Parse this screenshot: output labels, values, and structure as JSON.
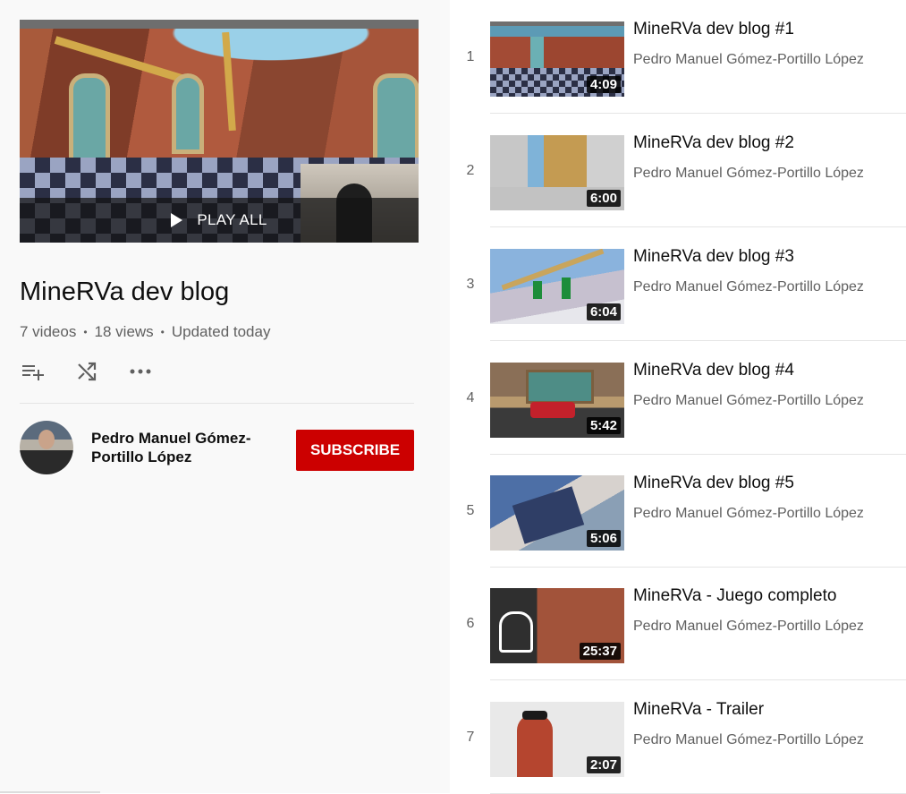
{
  "playlist": {
    "play_all_label": "PLAY ALL",
    "title": "MineRVa dev blog",
    "video_count": "7 videos",
    "views": "18 views",
    "updated": "Updated today",
    "stats_separator": "•"
  },
  "owner": {
    "name": "Pedro Manuel Gómez-Portillo López",
    "subscribe_label": "SUBSCRIBE"
  },
  "colors": {
    "subscribe": "#cc0000",
    "sidebar_bg": "#f9f9f9"
  },
  "icons": {
    "add_to_queue": "playlist-add-icon",
    "shuffle": "shuffle-icon",
    "more": "more-horiz-icon",
    "play": "play-icon"
  },
  "videos": [
    {
      "index": "1",
      "title": "MineRVa dev blog #1",
      "channel": "Pedro Manuel Gómez-Portillo López",
      "duration": "4:09"
    },
    {
      "index": "2",
      "title": "MineRVa dev blog #2",
      "channel": "Pedro Manuel Gómez-Portillo López",
      "duration": "6:00"
    },
    {
      "index": "3",
      "title": "MineRVa dev blog #3",
      "channel": "Pedro Manuel Gómez-Portillo López",
      "duration": "6:04"
    },
    {
      "index": "4",
      "title": "MineRVa dev blog #4",
      "channel": "Pedro Manuel Gómez-Portillo López",
      "duration": "5:42"
    },
    {
      "index": "5",
      "title": "MineRVa dev blog #5",
      "channel": "Pedro Manuel Gómez-Portillo López",
      "duration": "5:06"
    },
    {
      "index": "6",
      "title": "MineRVa - Juego completo",
      "channel": "Pedro Manuel Gómez-Portillo López",
      "duration": "25:37"
    },
    {
      "index": "7",
      "title": "MineRVa - Trailer",
      "channel": "Pedro Manuel Gómez-Portillo López",
      "duration": "2:07"
    }
  ]
}
